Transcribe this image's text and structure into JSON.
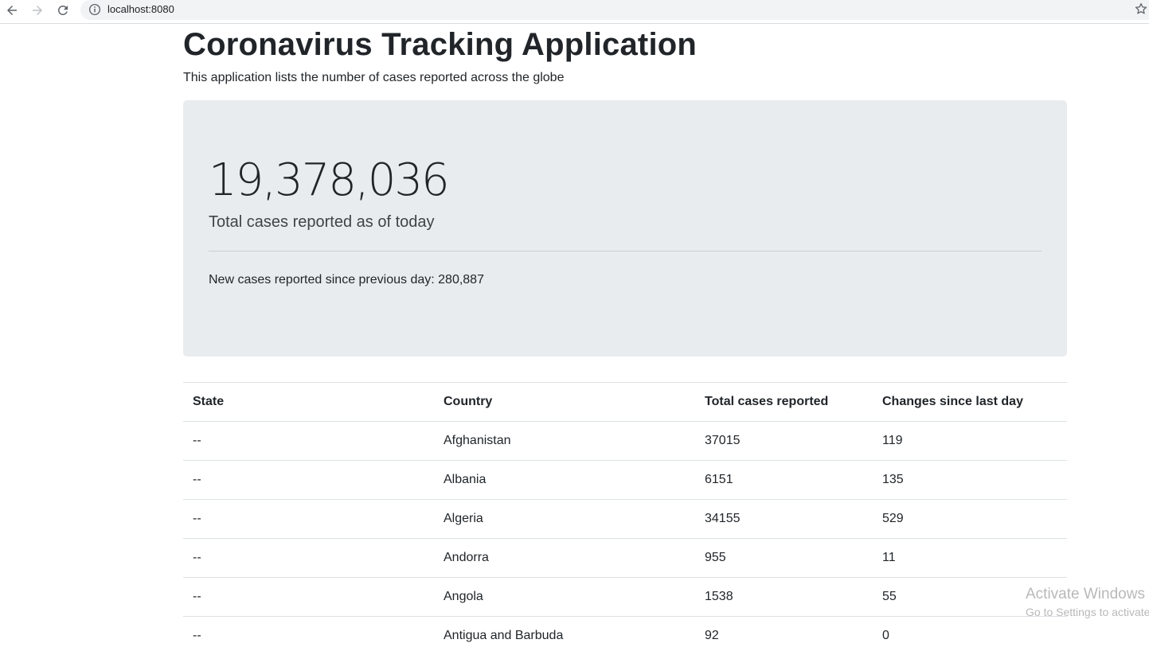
{
  "browser": {
    "url": "localhost:8080",
    "icons": [
      "back-arrow-icon",
      "forward-arrow-icon",
      "reload-icon",
      "info-icon",
      "star-icon"
    ]
  },
  "page": {
    "title": "Coronavirus Tracking Application",
    "subtitle": "This application lists the number of cases reported across the globe"
  },
  "summary": {
    "total_cases": "19,378,036",
    "total_caption": "Total cases reported as of today",
    "new_cases": "New cases reported since previous day: 280,887"
  },
  "table": {
    "headers": [
      "State",
      "Country",
      "Total cases reported",
      "Changes since last day"
    ],
    "rows": [
      [
        "--",
        "Afghanistan",
        "37015",
        "119"
      ],
      [
        "--",
        "Albania",
        "6151",
        "135"
      ],
      [
        "--",
        "Algeria",
        "34155",
        "529"
      ],
      [
        "--",
        "Andorra",
        "955",
        "11"
      ],
      [
        "--",
        "Angola",
        "1538",
        "55"
      ],
      [
        "--",
        "Antigua and Barbuda",
        "92",
        "0"
      ]
    ]
  },
  "watermark": {
    "line1": "Activate Windows",
    "line2": "Go to Settings to activate Windows."
  },
  "colors": {
    "jumbotron_bg": "#e9ecef",
    "text": "#212529",
    "border": "#dee2e6"
  }
}
